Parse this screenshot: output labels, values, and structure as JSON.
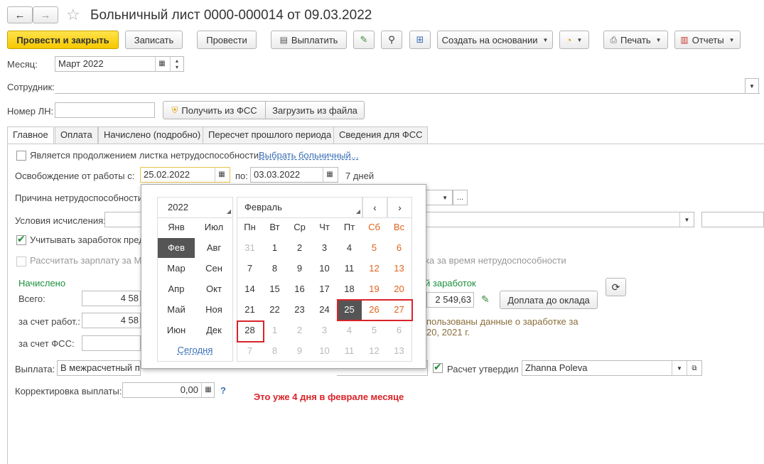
{
  "window": {
    "title": "Больничный лист 0000-000014 от 09.03.2022"
  },
  "toolbar": {
    "post_close": "Провести и закрыть",
    "save": "Записать",
    "post": "Провести",
    "pay": "Выплатить",
    "create_based": "Создать на основании",
    "print": "Печать",
    "reports": "Отчеты"
  },
  "form": {
    "month_label": "Месяц:",
    "month_value": "Март 2022",
    "employee_label": "Сотрудник:",
    "employee_value": "",
    "ln_label": "Номер ЛН:",
    "ln_value": "",
    "get_fss": "Получить из ФСС",
    "load_file": "Загрузить из файла"
  },
  "tabs": [
    "Главное",
    "Оплата",
    "Начислено (подробно)",
    "Пересчет прошлого периода",
    "Сведения для ФСС"
  ],
  "main": {
    "continuation_label": "Является продолжением листка нетрудоспособности:",
    "choose_sick_link": "Выбрать больничный...",
    "release_label": "Освобождение от работы с:",
    "date_from": "25.02.2022",
    "to_label": "по:",
    "date_to": "03.03.2022",
    "days": "7 дней",
    "reason_label": "Причина нетрудоспособности:",
    "conditions_label": "Условия исчисления:",
    "consider_earnings": "Учитывать заработок пред",
    "calc_salary": "Рассчитать зарплату за Ма",
    "calc_salary_tail": "ка за время нетрудоспособности",
    "accrued_header": "Начислено",
    "total_label": "Всего:",
    "total_value": "4 58",
    "employer_label": "за счет работ.:",
    "employer_value": "4 58",
    "fss_label": "за счет ФСС:",
    "avg_earnings_label": "й заработок",
    "avg_earnings_value": "2 549,63",
    "topup_button": "Доплата до оклада",
    "used_data_line1": "пользованы данные о заработке за",
    "used_data_line2": "20, 2021 г.",
    "payout_label": "Выплата:",
    "payout_value": "В межрасчетный пе",
    "calc_approved_label": "Расчет утвердил",
    "approver": "Zhanna Poleva",
    "correction_label": "Корректировка выплаты:",
    "correction_value": "0,00",
    "help": "?",
    "annotation": "Это уже 4 дня в феврале месяце"
  },
  "calendar": {
    "year": "2022",
    "month": "Февраль",
    "months_col1": [
      "Янв",
      "Фев",
      "Мар",
      "Апр",
      "Май",
      "Июн"
    ],
    "months_col2": [
      "Июл",
      "Авг",
      "Сен",
      "Окт",
      "Ноя",
      "Дек"
    ],
    "today": "Сегодня",
    "weekdays": [
      "Пн",
      "Вт",
      "Ср",
      "Чт",
      "Пт",
      "Сб",
      "Вс"
    ],
    "weeks": [
      [
        "31",
        "1",
        "2",
        "3",
        "4",
        "5",
        "6"
      ],
      [
        "7",
        "8",
        "9",
        "10",
        "11",
        "12",
        "13"
      ],
      [
        "14",
        "15",
        "16",
        "17",
        "18",
        "19",
        "20"
      ],
      [
        "21",
        "22",
        "23",
        "24",
        "25",
        "26",
        "27"
      ],
      [
        "28",
        "1",
        "2",
        "3",
        "4",
        "5",
        "6"
      ],
      [
        "7",
        "8",
        "9",
        "10",
        "11",
        "12",
        "13"
      ]
    ]
  }
}
